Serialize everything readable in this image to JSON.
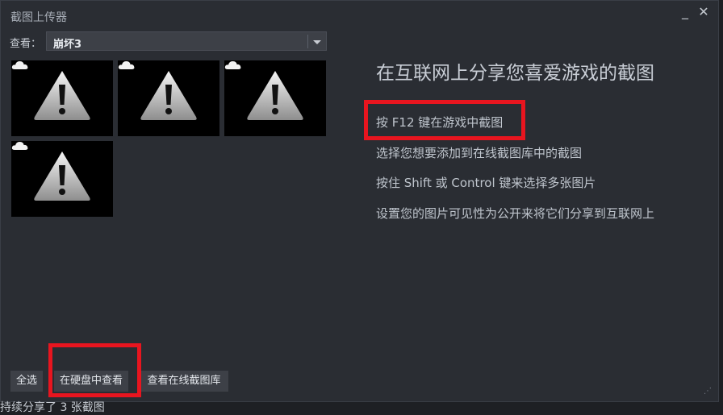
{
  "window": {
    "title": "截图上传器",
    "minimize_symbol": "_",
    "close_symbol": "✕"
  },
  "view": {
    "label": "查看：",
    "selected_game": "崩坏3"
  },
  "thumbnails": [
    {
      "icon": "warning-icon",
      "badge": "cloud-icon"
    },
    {
      "icon": "warning-icon",
      "badge": "cloud-icon"
    },
    {
      "icon": "warning-icon",
      "badge": "cloud-icon"
    },
    {
      "icon": "warning-icon",
      "badge": "cloud-icon"
    }
  ],
  "instructions": {
    "headline": "在互联网上分享您喜爱游戏的截图",
    "steps": [
      "按 F12 键在游戏中截图",
      "选择您想要添加到在线截图库中的截图",
      "按住 Shift 或 Control 键来选择多张图片",
      "设置您的图片可见性为公开来将它们分享到互联网上"
    ]
  },
  "buttons": {
    "select_all": "全选",
    "view_on_disk": "在硬盘中查看",
    "view_online_library": "查看在线截图库"
  },
  "status_text": "持续分享了 3 张截图",
  "colors": {
    "window_bg": "#2a2d33",
    "highlight": "#e8151f"
  }
}
